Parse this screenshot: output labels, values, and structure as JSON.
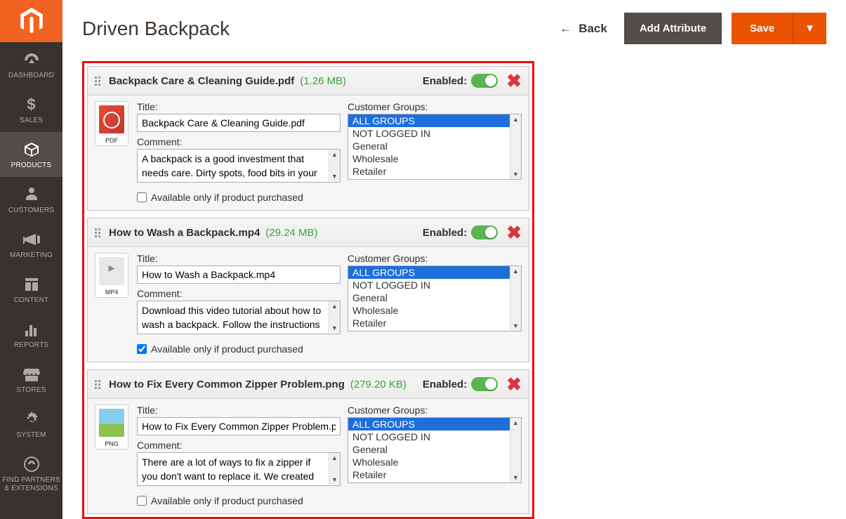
{
  "page_title": "Driven Backpack",
  "header": {
    "back_label": "Back",
    "add_attribute_label": "Add Attribute",
    "save_label": "Save"
  },
  "sidebar": {
    "items": [
      {
        "label": "DASHBOARD",
        "icon": "dashboard"
      },
      {
        "label": "SALES",
        "icon": "sales"
      },
      {
        "label": "PRODUCTS",
        "icon": "products",
        "active": true
      },
      {
        "label": "CUSTOMERS",
        "icon": "customers"
      },
      {
        "label": "MARKETING",
        "icon": "marketing"
      },
      {
        "label": "CONTENT",
        "icon": "content"
      },
      {
        "label": "REPORTS",
        "icon": "reports"
      },
      {
        "label": "STORES",
        "icon": "stores"
      },
      {
        "label": "SYSTEM",
        "icon": "system"
      },
      {
        "label": "FIND PARTNERS & EXTENSIONS",
        "icon": "partners"
      }
    ]
  },
  "labels": {
    "enabled": "Enabled:",
    "title": "Title:",
    "comment": "Comment:",
    "customer_groups": "Customer Groups:",
    "available_purchased": "Available only if product purchased"
  },
  "customer_groups": [
    "ALL GROUPS",
    "NOT LOGGED IN",
    "General",
    "Wholesale",
    "Retailer"
  ],
  "attachments": [
    {
      "filename": "Backpack Care & Cleaning Guide.pdf",
      "size": "(1.26 MB)",
      "ext": "PDF",
      "icon_class": "file-icon-pdf",
      "title": "Backpack Care & Cleaning Guide.pdf",
      "comment": "A backpack is a good investment that needs care. Dirty spots, food bits in your backpack, broken zippers are degrading",
      "enabled": true,
      "selected_group": "ALL GROUPS",
      "available_purchased": false
    },
    {
      "filename": "How to Wash a Backpack.mp4",
      "size": "(29.24 MB)",
      "ext": "MP4",
      "icon_class": "file-icon-mp4",
      "title": "How to Wash a Backpack.mp4",
      "comment": "Download this video tutorial about how to wash a backpack. Follow the instructions in this video and you will",
      "enabled": true,
      "selected_group": "ALL GROUPS",
      "available_purchased": true
    },
    {
      "filename": "How to Fix Every Common Zipper Problem.png",
      "size": "(279.20 KB)",
      "ext": "PNG",
      "icon_class": "file-icon-png",
      "title": "How to Fix Every Common Zipper Problem.png",
      "comment": "There are a lot of ways to fix a zipper if you don't want to replace it. We created an illustration that shows how to fix a",
      "enabled": true,
      "selected_group": "ALL GROUPS",
      "available_purchased": false
    }
  ]
}
